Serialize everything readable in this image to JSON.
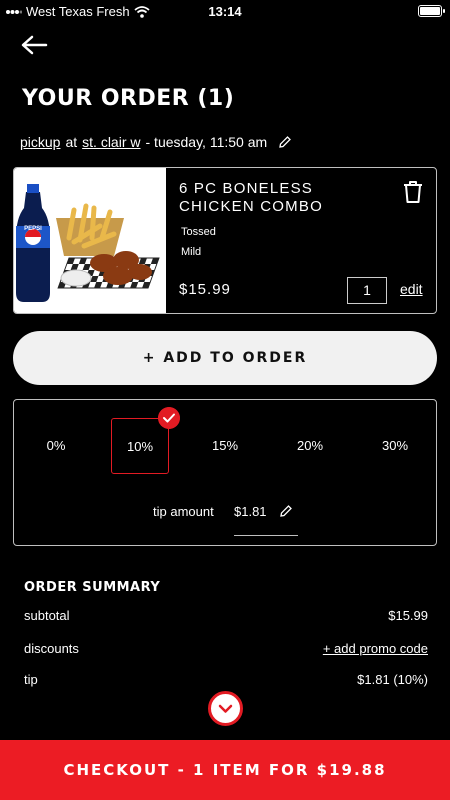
{
  "status_bar": {
    "carrier": "West Texas Fresh",
    "time": "13:14"
  },
  "header": {
    "title": "YOUR ORDER (1)"
  },
  "pickup": {
    "method": "pickup",
    "at": "at",
    "location": "st. clair w",
    "time": "- tuesday, 11:50 am"
  },
  "item": {
    "name": "6 PC BONELESS CHICKEN COMBO",
    "modifiers": [
      "Tossed",
      "Mild"
    ],
    "price": "$15.99",
    "quantity": "1",
    "edit_label": "edit",
    "image_brand": "PEPSI"
  },
  "add_button": {
    "label": "+ ADD TO ORDER"
  },
  "tip": {
    "options": [
      "0%",
      "10%",
      "15%",
      "20%",
      "30%"
    ],
    "selected": "10%",
    "amount_label": "tip amount",
    "amount_value": "$1.81"
  },
  "summary": {
    "title": "ORDER SUMMARY",
    "rows": [
      {
        "label": "subtotal",
        "value": "$15.99"
      },
      {
        "label": "discounts",
        "value": "+ add promo code"
      },
      {
        "label": "tip",
        "value": "$1.81 (10%)"
      }
    ]
  },
  "checkout": {
    "label": "CHECKOUT - 1 ITEM FOR $19.88"
  },
  "colors": {
    "accent": "#ec1c24",
    "background": "#000000",
    "button_bg": "#f1f1f1"
  }
}
